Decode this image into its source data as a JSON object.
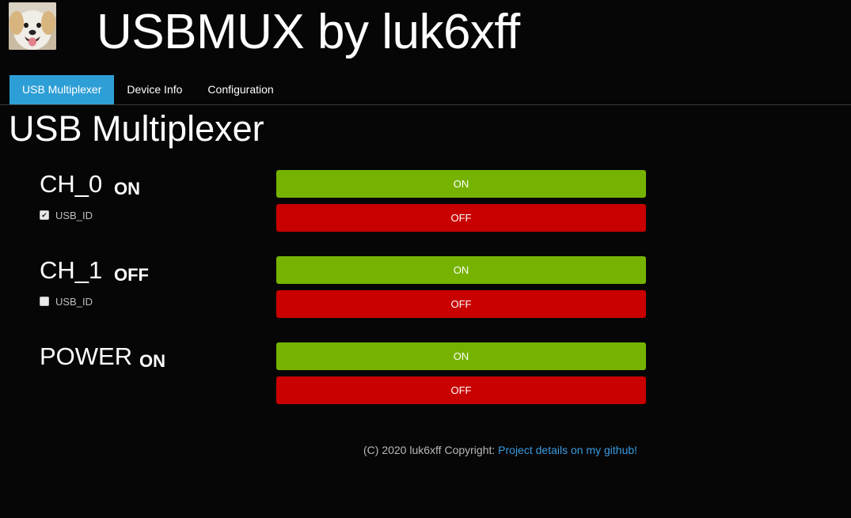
{
  "header": {
    "title": "USBMUX by luk6xff"
  },
  "tabs": [
    {
      "label": "USB Multiplexer",
      "active": true
    },
    {
      "label": "Device Info",
      "active": false
    },
    {
      "label": "Configuration",
      "active": false
    }
  ],
  "page": {
    "title": "USB Multiplexer"
  },
  "channels": [
    {
      "name": "CH_0",
      "state": "ON",
      "usb_id_label": "USB_ID",
      "usb_id_checked": true,
      "on_label": "ON",
      "off_label": "OFF"
    },
    {
      "name": "CH_1",
      "state": "OFF",
      "usb_id_label": "USB_ID",
      "usb_id_checked": false,
      "on_label": "ON",
      "off_label": "OFF"
    },
    {
      "name": "POWER",
      "state": "ON",
      "on_label": "ON",
      "off_label": "OFF"
    }
  ],
  "footer": {
    "text": "(C) 2020 luk6xff Copyright: ",
    "link_text": "Project details on my github!"
  },
  "colors": {
    "background": "#060606",
    "tab_active": "#2e9fd6",
    "button_on": "#76b300",
    "button_off": "#c80000",
    "link": "#3a9be0"
  }
}
